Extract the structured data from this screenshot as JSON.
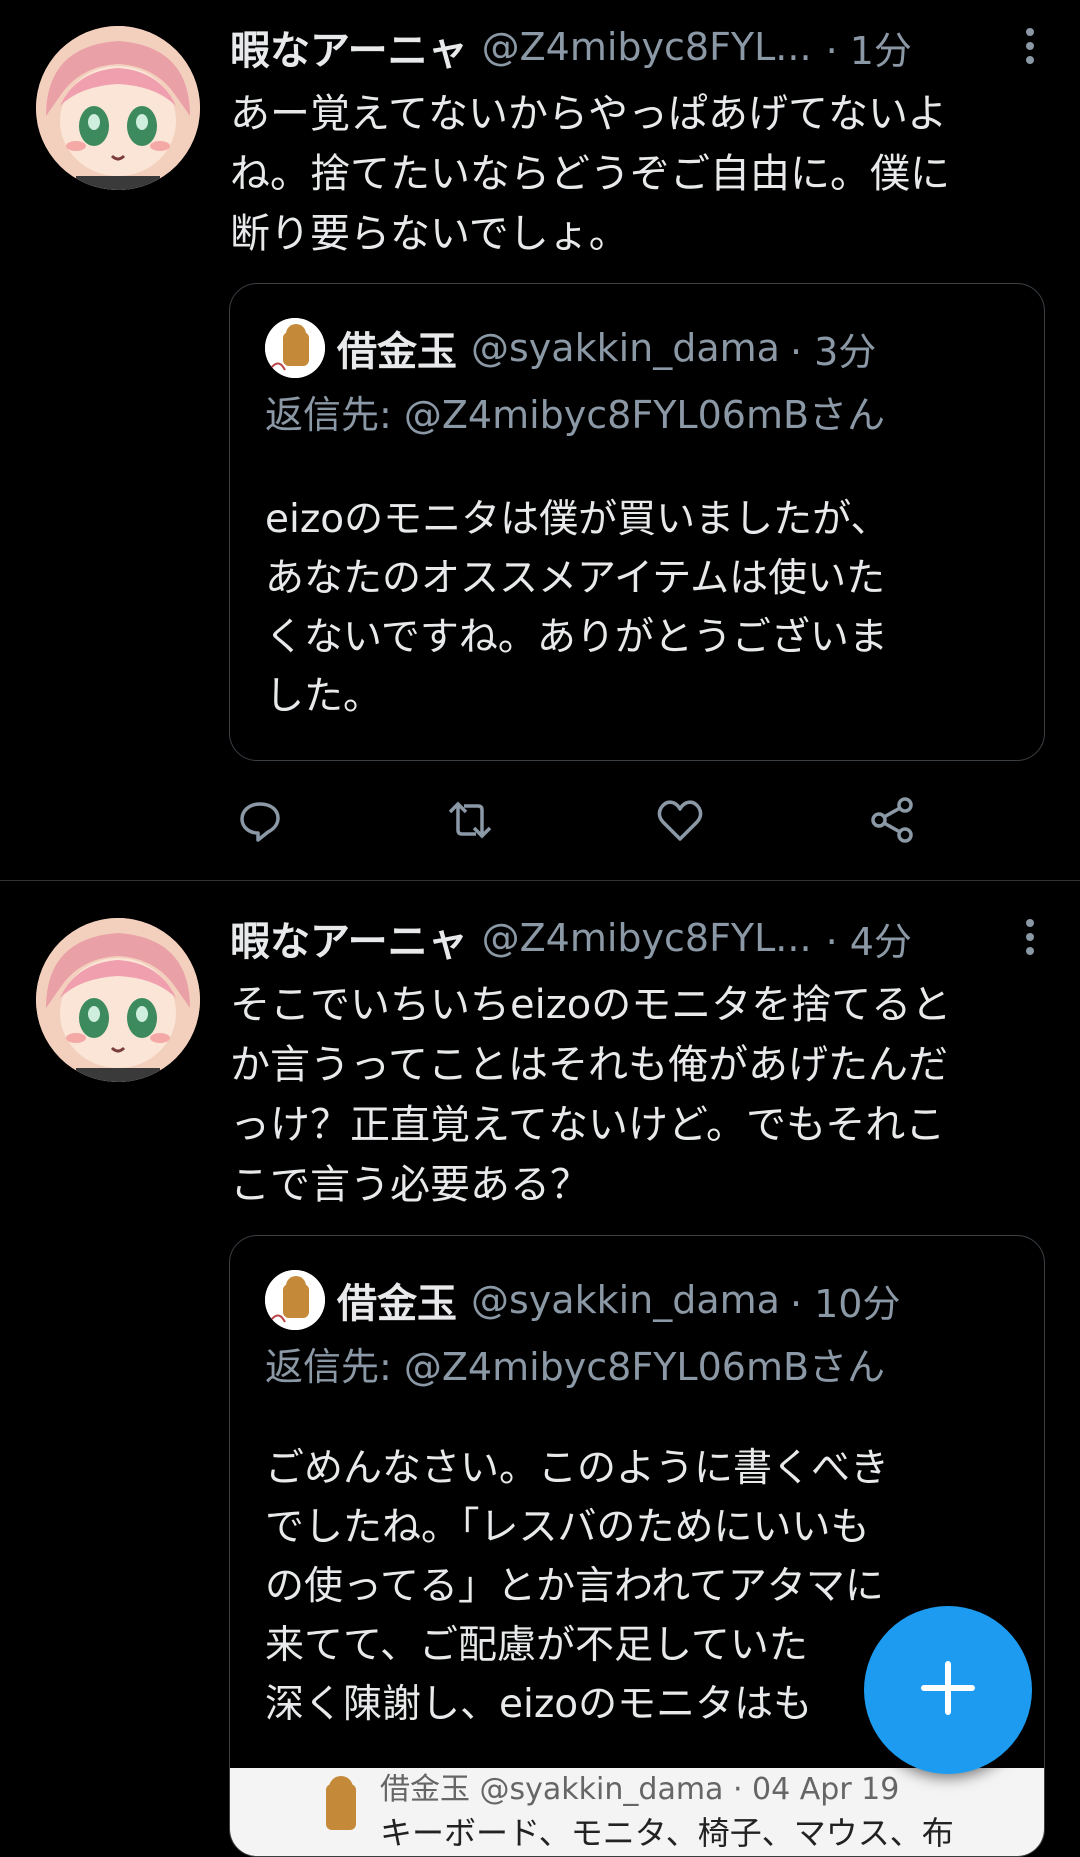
{
  "tweets": [
    {
      "author_name": "暇なアーニャ",
      "author_handle": "@Z4mibyc8FYL...",
      "time": "· 1分",
      "text_lines": [
        "あー覚えてないからやっぱあげてないよ",
        "ね。捨てたいならどうぞご自由に。僕に",
        "断り要らないでしょ。"
      ],
      "quote": {
        "author_name": "借金玉",
        "author_handle": "@syakkin_dama",
        "time": "· 3分",
        "reply_to": "返信先: @Z4mibyc8FYL06mBさん",
        "text_lines": [
          "eizoのモニタは僕が買いましたが、",
          "あなたのオススメアイテムは使いた",
          "くないですね。ありがとうございま",
          "した。"
        ]
      }
    },
    {
      "author_name": "暇なアーニャ",
      "author_handle": "@Z4mibyc8FYL...",
      "time": "· 4分",
      "text_lines": [
        "そこでいちいちeizoのモニタを捨てると",
        "か言うってことはそれも俺があげたんだ",
        "っけ？正直覚えてないけど。でもそれこ",
        "こで言う必要ある？"
      ],
      "quote": {
        "author_name": "借金玉",
        "author_handle": "@syakkin_dama",
        "time": "· 10分",
        "reply_to": "返信先: @Z4mibyc8FYL06mBさん",
        "text_lines": [
          "ごめんなさい。このように書くべき",
          "でしたね。「レスバのためにいいも",
          "の使ってる」とか言われてアタマに",
          "来てて、ご配慮が不足していた",
          "深く陳謝し、eizoのモニタはも"
        ],
        "embed_text": "借金玉 @syakkin_dama · 04 Apr 19",
        "embed_text_2": "キーボード、モニタ、椅子、マウス、布"
      }
    }
  ],
  "icons": {
    "reply": "reply-icon",
    "retweet": "retweet-icon",
    "like": "heart-icon",
    "share": "share-icon",
    "compose": "compose-plus-icon",
    "more": "more-vertical-icon"
  },
  "colors": {
    "accent": "#1d9bf0",
    "muted": "#8b98a5",
    "background": "#000000"
  }
}
